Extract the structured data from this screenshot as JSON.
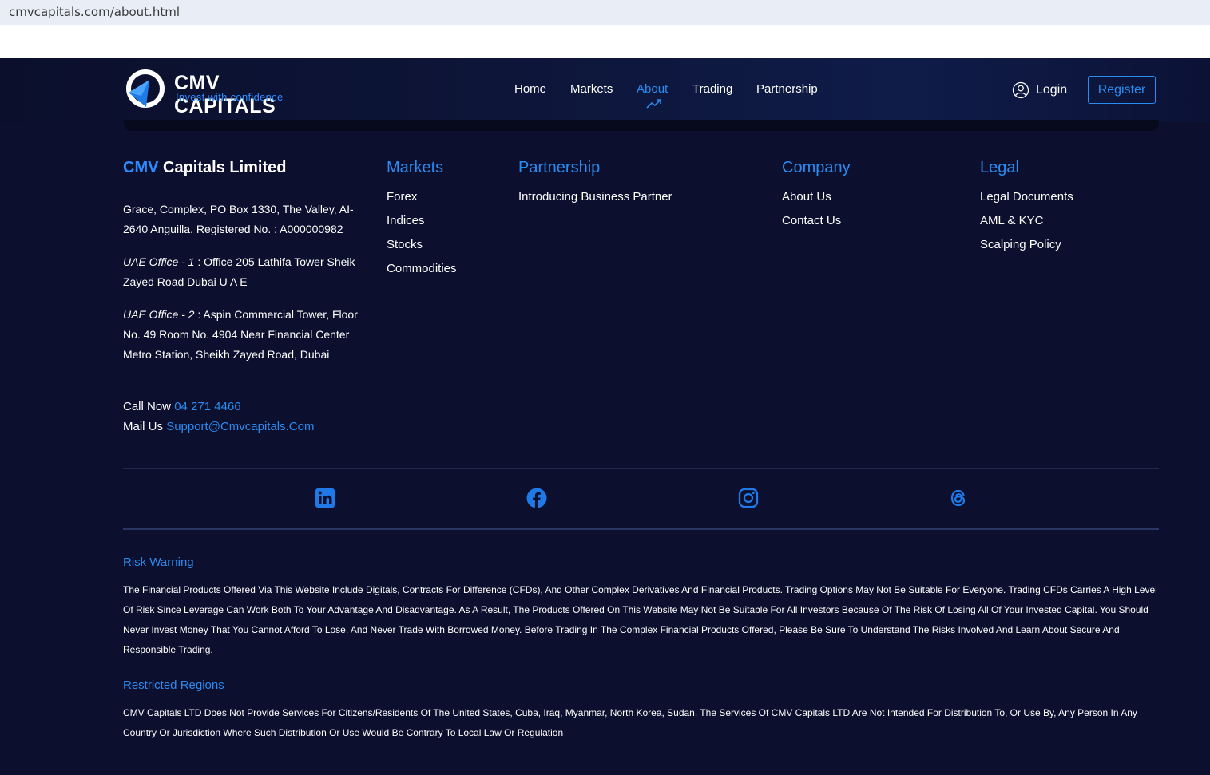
{
  "browser": {
    "url": "cmvcapitals.com/about.html"
  },
  "brand": {
    "name": "CMV CAPITALS",
    "tagline": "Invest with confidence",
    "accent": "#2a8cf0",
    "background": "#0c0f2e"
  },
  "nav": {
    "items": [
      {
        "label": "Home",
        "active": false
      },
      {
        "label": "Markets",
        "active": false
      },
      {
        "label": "About",
        "active": true
      },
      {
        "label": "Trading",
        "active": false
      },
      {
        "label": "Partnership",
        "active": false
      }
    ],
    "login_label": "Login",
    "login_icon": "user-circle-icon",
    "register_label": "Register"
  },
  "footer": {
    "company": {
      "title_highlight": "CMV",
      "title_rest": "Capitals Limited",
      "address": "Grace, Complex, PO Box 1330, The Valley, AI-2640 Anguilla. Registered No. : A000000982",
      "office1_label": "UAE Office - 1",
      "office1_text": ": Office 205 Lathifa Tower Sheik Zayed Road Dubai U A E",
      "office2_label": "UAE Office - 2",
      "office2_text": ": Aspin Commercial Tower, Floor No. 49 Room No. 4904 Near Financial Center Metro Station, Sheikh Zayed Road, Dubai",
      "call_label": "Call Now",
      "call_value": "04 271 4466",
      "mail_label": "Mail Us",
      "mail_value": "Support@Cmvcapitals.Com"
    },
    "columns": [
      {
        "title": "Markets",
        "links": [
          "Forex",
          "Indices",
          "Stocks",
          "Commodities"
        ]
      },
      {
        "title": "Partnership",
        "links": [
          "Introducing Business Partner"
        ]
      },
      {
        "title": "Company",
        "links": [
          "About Us",
          "Contact Us"
        ]
      },
      {
        "title": "Legal",
        "links": [
          "Legal Documents",
          "AML & KYC",
          "Scalping Policy"
        ]
      }
    ],
    "social": [
      "linkedin-icon",
      "facebook-icon",
      "instagram-icon",
      "threads-icon"
    ],
    "risk_warning": {
      "title": "Risk Warning",
      "text": "The Financial Products Offered Via This Website Include Digitals, Contracts For Difference (CFDs), And Other Complex Derivatives And Financial Products. Trading Options May Not Be Suitable For Everyone. Trading CFDs Carries A High Level Of Risk Since Leverage Can Work Both To Your Advantage And Disadvantage. As A Result, The Products Offered On This Website May Not Be Suitable For All Investors Because Of The Risk Of Losing All Of Your Invested Capital. You Should Never Invest Money That You Cannot Afford To Lose, And Never Trade With Borrowed Money. Before Trading In The Complex Financial Products Offered, Please Be Sure To Understand The Risks Involved And Learn About Secure And Responsible Trading."
    },
    "restricted": {
      "title": "Restricted Regions",
      "text": "CMV Capitals LTD Does Not Provide Services For Citizens/Residents Of The United States, Cuba, Iraq, Myanmar, North Korea, Sudan. The Services Of CMV Capitals LTD Are Not Intended For Distribution To, Or Use By, Any Person In Any Country Or Jurisdiction Where Such Distribution Or Use Would Be Contrary To Local Law Or Regulation"
    }
  }
}
